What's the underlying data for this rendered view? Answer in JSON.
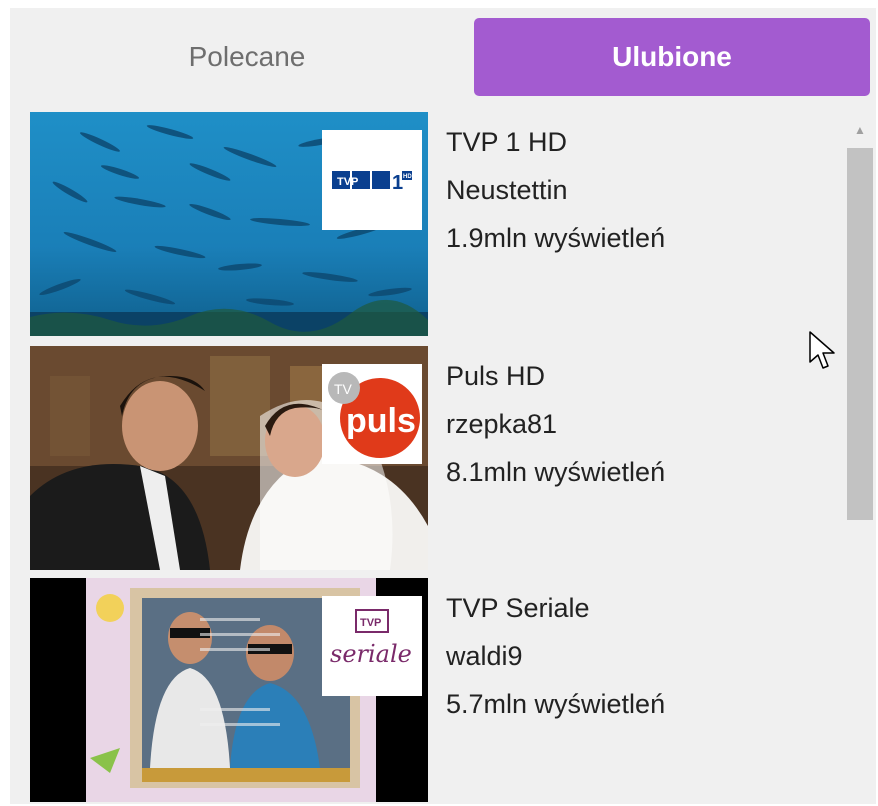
{
  "tabs": {
    "recommended": "Polecane",
    "favorites": "Ulubione"
  },
  "colors": {
    "accent": "#a35bd0",
    "panel_bg": "#f0f0f0",
    "text": "#222222",
    "inactive_tab_text": "#6e6e6e"
  },
  "channels": [
    {
      "name": "TVP 1 HD",
      "user": "Neustettin",
      "views": "1.9mln wyświetleń",
      "logo_icon": "tvp1-hd-logo"
    },
    {
      "name": "Puls HD",
      "user": "rzepka81",
      "views": "8.1mln wyświetleń",
      "logo_icon": "tv-puls-logo"
    },
    {
      "name": "TVP Seriale",
      "user": "waldi9",
      "views": "5.7mln wyświetleń",
      "logo_icon": "tvp-seriale-logo"
    }
  ],
  "logos": {
    "tvp1_letters": "TVP",
    "tvp1_number": "1",
    "tvp1_hd": "HD",
    "puls_tv": "TV",
    "puls_word": "puls",
    "seriale_tvp": "TVP",
    "seriale_word": "seriale"
  }
}
